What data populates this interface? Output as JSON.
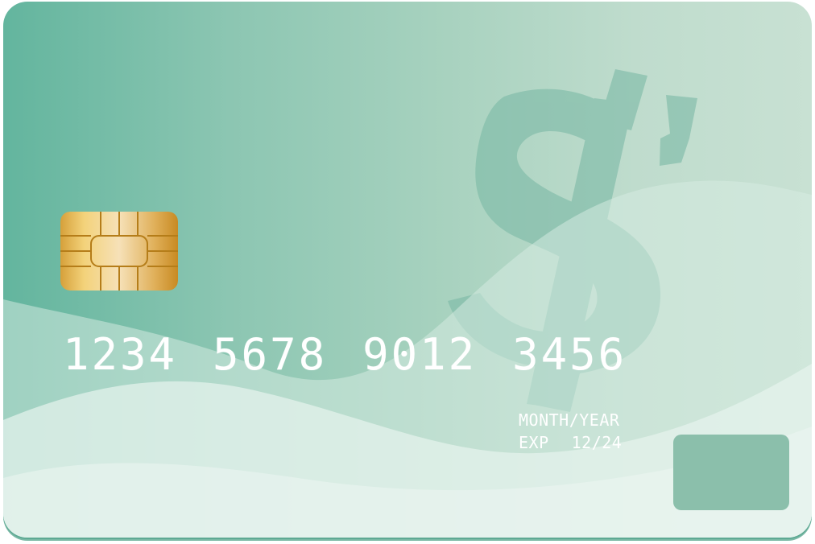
{
  "card": {
    "number_groups": [
      "1234",
      "5678",
      "9012",
      "3456"
    ],
    "expiry_label": "MONTH/YEAR",
    "expiry_prefix": "EXP",
    "expiry_value": "12/24"
  },
  "icons": {
    "chip": "emv-chip-icon",
    "watermark": "dollar-sign-icon"
  },
  "colors": {
    "card_primary": "#63b59e",
    "card_light": "#c8e1d3",
    "chip_gold": "#d8a93f",
    "signature_pad": "#8bbfab"
  }
}
